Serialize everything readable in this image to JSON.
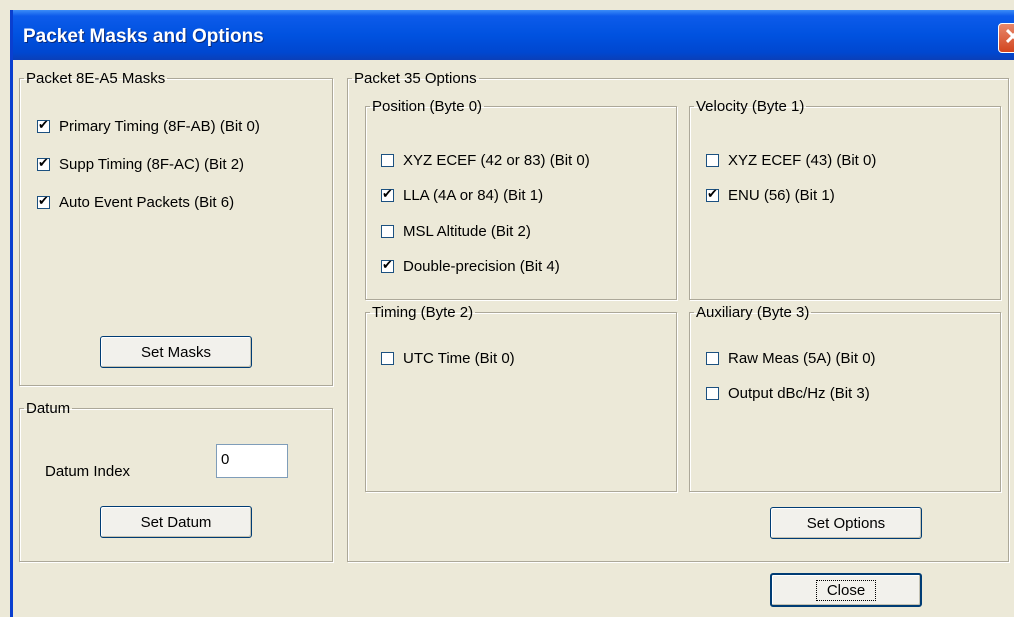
{
  "window": {
    "title": "Packet Masks and Options",
    "close_glyph": "✕"
  },
  "masks": {
    "legend": "Packet 8E-A5 Masks",
    "items": [
      {
        "label": "Primary Timing (8F-AB) (Bit 0)",
        "checked": true
      },
      {
        "label": "Supp Timing (8F-AC) (Bit 2)",
        "checked": true
      },
      {
        "label": "Auto Event Packets (Bit 6)",
        "checked": true
      }
    ],
    "button": "Set Masks"
  },
  "datum": {
    "legend": "Datum",
    "index_label": "Datum Index",
    "index_value": "0",
    "button": "Set Datum"
  },
  "options": {
    "legend": "Packet 35 Options",
    "position": {
      "legend": "Position (Byte 0)",
      "items": [
        {
          "label": "XYZ ECEF (42 or 83) (Bit 0)",
          "checked": false
        },
        {
          "label": "LLA (4A or 84) (Bit 1)",
          "checked": true
        },
        {
          "label": "MSL Altitude (Bit 2)",
          "checked": false
        },
        {
          "label": "Double-precision (Bit 4)",
          "checked": true
        }
      ]
    },
    "velocity": {
      "legend": "Velocity (Byte 1)",
      "items": [
        {
          "label": "XYZ ECEF (43) (Bit 0)",
          "checked": false
        },
        {
          "label": "ENU (56) (Bit 1)",
          "checked": true
        }
      ]
    },
    "timing": {
      "legend": "Timing (Byte 2)",
      "items": [
        {
          "label": "UTC Time (Bit 0)",
          "checked": false
        }
      ]
    },
    "auxiliary": {
      "legend": "Auxiliary (Byte 3)",
      "items": [
        {
          "label": "Raw Meas (5A) (Bit 0)",
          "checked": false
        },
        {
          "label": "Output dBc/Hz (Bit 3)",
          "checked": false
        }
      ]
    },
    "button": "Set Options"
  },
  "close_button": "Close"
}
